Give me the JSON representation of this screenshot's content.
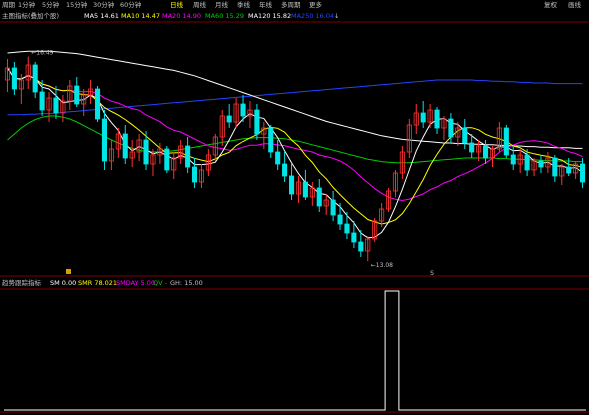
{
  "toolbar": {
    "periods": [
      {
        "label": "周期",
        "active": false
      },
      {
        "label": "1分钟",
        "active": false
      },
      {
        "label": "5分钟",
        "active": false
      },
      {
        "label": "15分钟",
        "active": false
      },
      {
        "label": "30分钟",
        "active": false
      },
      {
        "label": "60分钟",
        "active": false
      },
      {
        "label": "日线",
        "active": true
      },
      {
        "label": "周线",
        "active": false
      },
      {
        "label": "月线",
        "active": false
      },
      {
        "label": "季线",
        "active": false
      },
      {
        "label": "年线",
        "active": false
      },
      {
        "label": "多周期",
        "active": false
      },
      {
        "label": "更多",
        "active": false
      }
    ],
    "right_1": "复权",
    "right_2": "画线"
  },
  "legend": {
    "title": "主图指标(叠加个股)",
    "ma5": "MA5 14.61",
    "ma10": "MA10 14.47",
    "ma20": "MA20 14.90",
    "ma60": "MA60 15.29",
    "ma120": "MA120 15.82",
    "ma250": "MA250 16.04"
  },
  "sub_legend": {
    "title": "趋势跟踪指标",
    "sm": "SM 0.00",
    "smr": "SMR 78.021",
    "smday": "SMDAY 5.00",
    "qv": "QV -",
    "gh": "GH: 15.00"
  },
  "annotations": {
    "high": "16.49",
    "low": "13.08",
    "marker": "S"
  },
  "colors": {
    "bg": "#000000",
    "up": "#ff3232",
    "down": "#00e5e5",
    "ma5": "#ffffff",
    "ma10": "#ffff00",
    "ma20": "#ff00ff",
    "ma60": "#00cc00",
    "ma120": "#ffffff",
    "ma250": "#2244ff",
    "grid": "#7a0000"
  },
  "chart_data": {
    "type": "candlestick",
    "ylim": [
      12.9,
      17.0
    ],
    "candles": [
      [
        16.1,
        16.45,
        15.9,
        16.3
      ],
      [
        16.3,
        16.4,
        15.85,
        15.95
      ],
      [
        15.95,
        16.2,
        15.7,
        16.1
      ],
      [
        16.1,
        16.49,
        15.95,
        16.35
      ],
      [
        16.35,
        16.4,
        15.8,
        15.9
      ],
      [
        15.9,
        16.1,
        15.5,
        15.6
      ],
      [
        15.6,
        15.9,
        15.4,
        15.8
      ],
      [
        15.8,
        16.0,
        15.45,
        15.55
      ],
      [
        15.55,
        15.85,
        15.4,
        15.75
      ],
      [
        15.75,
        16.1,
        15.6,
        16.0
      ],
      [
        16.0,
        16.15,
        15.65,
        15.7
      ],
      [
        15.7,
        15.95,
        15.5,
        15.85
      ],
      [
        15.85,
        16.1,
        15.7,
        15.95
      ],
      [
        15.95,
        16.0,
        15.4,
        15.45
      ],
      [
        15.45,
        15.6,
        14.6,
        14.75
      ],
      [
        14.75,
        15.1,
        14.6,
        14.95
      ],
      [
        14.95,
        15.3,
        14.8,
        15.2
      ],
      [
        15.2,
        15.35,
        14.7,
        14.8
      ],
      [
        14.8,
        15.1,
        14.65,
        14.9
      ],
      [
        14.9,
        15.2,
        14.75,
        15.1
      ],
      [
        15.1,
        15.25,
        14.6,
        14.7
      ],
      [
        14.7,
        14.95,
        14.5,
        14.85
      ],
      [
        14.85,
        15.05,
        14.7,
        14.95
      ],
      [
        14.95,
        15.0,
        14.55,
        14.6
      ],
      [
        14.6,
        14.9,
        14.45,
        14.8
      ],
      [
        14.8,
        15.1,
        14.7,
        15.0
      ],
      [
        15.0,
        15.15,
        14.55,
        14.65
      ],
      [
        14.65,
        14.8,
        14.3,
        14.4
      ],
      [
        14.4,
        14.7,
        14.3,
        14.6
      ],
      [
        14.6,
        14.95,
        14.5,
        14.85
      ],
      [
        14.85,
        15.2,
        14.75,
        15.15
      ],
      [
        15.15,
        15.6,
        15.0,
        15.5
      ],
      [
        15.5,
        15.7,
        15.3,
        15.4
      ],
      [
        15.4,
        15.8,
        15.3,
        15.7
      ],
      [
        15.7,
        15.85,
        15.4,
        15.5
      ],
      [
        15.5,
        15.75,
        15.3,
        15.6
      ],
      [
        15.6,
        15.7,
        15.1,
        15.2
      ],
      [
        15.2,
        15.4,
        14.95,
        15.3
      ],
      [
        15.3,
        15.35,
        14.8,
        14.9
      ],
      [
        14.9,
        15.1,
        14.6,
        14.7
      ],
      [
        14.7,
        14.9,
        14.4,
        14.5
      ],
      [
        14.5,
        14.7,
        14.1,
        14.2
      ],
      [
        14.2,
        14.5,
        14.05,
        14.4
      ],
      [
        14.4,
        14.6,
        14.1,
        14.15
      ],
      [
        14.15,
        14.4,
        14.0,
        14.3
      ],
      [
        14.3,
        14.45,
        13.9,
        14.0
      ],
      [
        14.0,
        14.2,
        13.85,
        14.1
      ],
      [
        14.1,
        14.25,
        13.75,
        13.85
      ],
      [
        13.85,
        14.05,
        13.6,
        13.7
      ],
      [
        13.7,
        13.9,
        13.45,
        13.55
      ],
      [
        13.55,
        13.75,
        13.3,
        13.4
      ],
      [
        13.4,
        13.6,
        13.15,
        13.25
      ],
      [
        13.25,
        13.5,
        13.08,
        13.45
      ],
      [
        13.45,
        13.8,
        13.4,
        13.75
      ],
      [
        13.75,
        14.05,
        13.65,
        13.95
      ],
      [
        13.95,
        14.3,
        13.9,
        14.25
      ],
      [
        14.25,
        14.6,
        14.15,
        14.55
      ],
      [
        14.55,
        15.0,
        14.45,
        14.9
      ],
      [
        14.9,
        15.45,
        14.8,
        15.35
      ],
      [
        15.35,
        15.7,
        15.2,
        15.55
      ],
      [
        15.55,
        15.75,
        15.3,
        15.4
      ],
      [
        15.4,
        15.7,
        15.3,
        15.6
      ],
      [
        15.6,
        15.65,
        15.2,
        15.3
      ],
      [
        15.3,
        15.5,
        15.1,
        15.45
      ],
      [
        15.45,
        15.55,
        15.05,
        15.15
      ],
      [
        15.15,
        15.4,
        15.0,
        15.3
      ],
      [
        15.3,
        15.45,
        14.95,
        15.05
      ],
      [
        15.05,
        15.2,
        14.8,
        14.9
      ],
      [
        14.9,
        15.1,
        14.75,
        15.0
      ],
      [
        15.0,
        15.1,
        14.7,
        14.8
      ],
      [
        14.8,
        15.0,
        14.65,
        14.95
      ],
      [
        14.95,
        15.4,
        14.9,
        15.3
      ],
      [
        15.3,
        15.35,
        14.8,
        14.85
      ],
      [
        14.85,
        15.0,
        14.6,
        14.7
      ],
      [
        14.7,
        14.95,
        14.55,
        14.85
      ],
      [
        14.85,
        14.95,
        14.5,
        14.6
      ],
      [
        14.6,
        14.8,
        14.5,
        14.75
      ],
      [
        14.75,
        14.85,
        14.55,
        14.65
      ],
      [
        14.65,
        14.9,
        14.55,
        14.8
      ],
      [
        14.8,
        14.85,
        14.4,
        14.5
      ],
      [
        14.5,
        14.7,
        14.35,
        14.65
      ],
      [
        14.65,
        14.8,
        14.5,
        14.55
      ],
      [
        14.55,
        14.75,
        14.45,
        14.7
      ],
      [
        14.7,
        14.8,
        14.3,
        14.4
      ]
    ],
    "ma60": [
      15.1,
      15.2,
      15.3,
      15.38,
      15.44,
      15.48,
      15.5,
      15.5,
      15.48,
      15.45,
      15.4,
      15.34,
      15.28,
      15.22,
      15.16,
      15.1,
      15.05,
      15.0,
      14.96,
      14.93,
      14.91,
      14.9,
      14.9,
      14.91,
      14.92,
      14.94,
      14.96,
      14.98,
      15.0,
      15.02,
      15.04,
      15.06,
      15.08,
      15.1,
      15.12,
      15.13,
      15.14,
      15.14,
      15.14,
      15.13,
      15.12,
      15.1,
      15.08,
      15.05,
      15.02,
      14.99,
      14.96,
      14.93,
      14.9,
      14.87,
      14.84,
      14.81,
      14.78,
      14.76,
      14.74,
      14.73,
      14.72,
      14.72,
      14.72,
      14.73,
      14.74,
      14.75,
      14.76,
      14.77,
      14.78,
      14.79,
      14.8,
      14.8,
      14.8,
      14.8,
      14.8,
      14.79,
      14.79,
      14.78,
      14.78,
      14.77,
      14.77,
      14.76,
      14.76,
      14.75,
      14.75,
      14.75,
      14.74,
      14.74
    ],
    "ma120": [
      16.55,
      16.56,
      16.57,
      16.58,
      16.58,
      16.58,
      16.58,
      16.57,
      16.56,
      16.55,
      16.54,
      16.52,
      16.5,
      16.48,
      16.46,
      16.44,
      16.42,
      16.4,
      16.38,
      16.36,
      16.34,
      16.32,
      16.3,
      16.28,
      16.26,
      16.23,
      16.2,
      16.17,
      16.13,
      16.09,
      16.05,
      16.01,
      15.97,
      15.93,
      15.89,
      15.85,
      15.81,
      15.77,
      15.73,
      15.69,
      15.65,
      15.61,
      15.57,
      15.53,
      15.49,
      15.45,
      15.41,
      15.38,
      15.35,
      15.32,
      15.29,
      15.26,
      15.23,
      15.2,
      15.17,
      15.15,
      15.13,
      15.11,
      15.1,
      15.09,
      15.08,
      15.07,
      15.06,
      15.05,
      15.05,
      15.04,
      15.04,
      15.03,
      15.03,
      15.02,
      15.02,
      15.01,
      15.01,
      15.0,
      15.0,
      14.99,
      14.99,
      14.98,
      14.98,
      14.97,
      14.97,
      14.97,
      14.96,
      14.96
    ],
    "ma250": [
      15.52,
      15.52,
      15.52,
      15.53,
      15.53,
      15.54,
      15.54,
      15.55,
      15.56,
      15.57,
      15.58,
      15.59,
      15.6,
      15.61,
      15.62,
      15.63,
      15.64,
      15.65,
      15.66,
      15.67,
      15.68,
      15.69,
      15.7,
      15.71,
      15.72,
      15.73,
      15.74,
      15.75,
      15.76,
      15.77,
      15.78,
      15.79,
      15.8,
      15.81,
      15.82,
      15.83,
      15.84,
      15.85,
      15.86,
      15.87,
      15.88,
      15.89,
      15.9,
      15.91,
      15.92,
      15.93,
      15.94,
      15.95,
      15.96,
      15.97,
      15.98,
      15.99,
      16.0,
      16.01,
      16.02,
      16.03,
      16.04,
      16.05,
      16.06,
      16.07,
      16.08,
      16.09,
      16.1,
      16.1,
      16.1,
      16.1,
      16.1,
      16.1,
      16.09,
      16.09,
      16.08,
      16.08,
      16.07,
      16.07,
      16.06,
      16.06,
      16.05,
      16.05,
      16.05,
      16.04,
      16.04,
      16.04,
      16.04,
      16.04
    ],
    "sub_values": [
      0,
      0,
      0,
      0,
      0,
      0,
      0,
      0,
      0,
      0,
      0,
      0,
      0,
      0,
      0,
      0,
      0,
      0,
      0,
      0,
      0,
      0,
      0,
      0,
      0,
      0,
      0,
      0,
      0,
      0,
      0,
      0,
      0,
      0,
      0,
      0,
      0,
      0,
      0,
      0,
      0,
      0,
      0,
      0,
      0,
      0,
      0,
      0,
      0,
      0,
      0,
      0,
      0,
      0,
      0,
      100,
      100,
      0,
      0,
      0,
      0,
      0,
      0,
      0,
      0,
      0,
      0,
      0,
      0,
      0,
      0,
      0,
      0,
      0,
      0,
      0,
      0,
      0,
      0,
      0,
      0,
      0,
      0,
      0
    ],
    "sub_ylim": [
      0,
      100
    ]
  }
}
